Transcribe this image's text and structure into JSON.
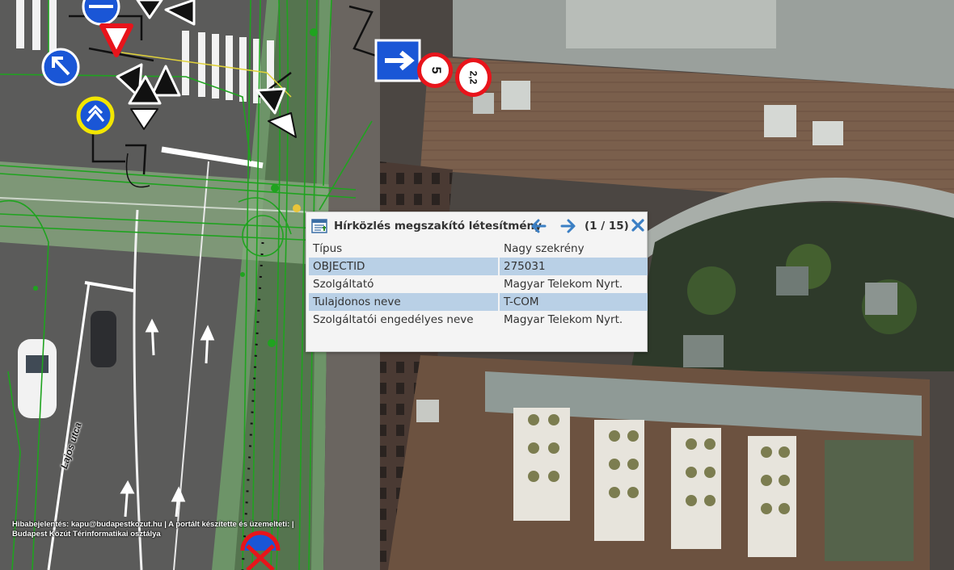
{
  "popup": {
    "title": "Hírközlés megszakító létesítmény",
    "counter": "(1 / 15)",
    "rows": [
      {
        "key": "Típus",
        "value": "Nagy szekrény"
      },
      {
        "key": "OBJECTID",
        "value": "275031"
      },
      {
        "key": "Szolgáltató",
        "value": "Magyar Telekom Nyrt."
      },
      {
        "key": "Tulajdonos neve",
        "value": "T-COM"
      },
      {
        "key": "Szolgáltatói engedélyes neve",
        "value": "Magyar Telekom Nyrt."
      }
    ],
    "icons": {
      "layer": "table-icon",
      "prev": "arrow-left-icon",
      "next": "arrow-right-icon",
      "close": "close-icon"
    },
    "colors": {
      "nav": "#3b7fc4",
      "highlight_row": "#b9d0e6"
    }
  },
  "map": {
    "street_name": "Lajos utca",
    "signs": {
      "speed_limit": "5",
      "weight_limit": "2,2"
    },
    "colors": {
      "roads_overlay": "#1fa31f",
      "sign_blue": "#1a56d6",
      "sign_red": "#e8141b"
    }
  },
  "footer": {
    "line1": "Hibabejelentés: kapu@budapestkozut.hu | A portált készítette és üzemelteti: |",
    "line2": "Budapest Közút Térinformatikai osztálya"
  }
}
